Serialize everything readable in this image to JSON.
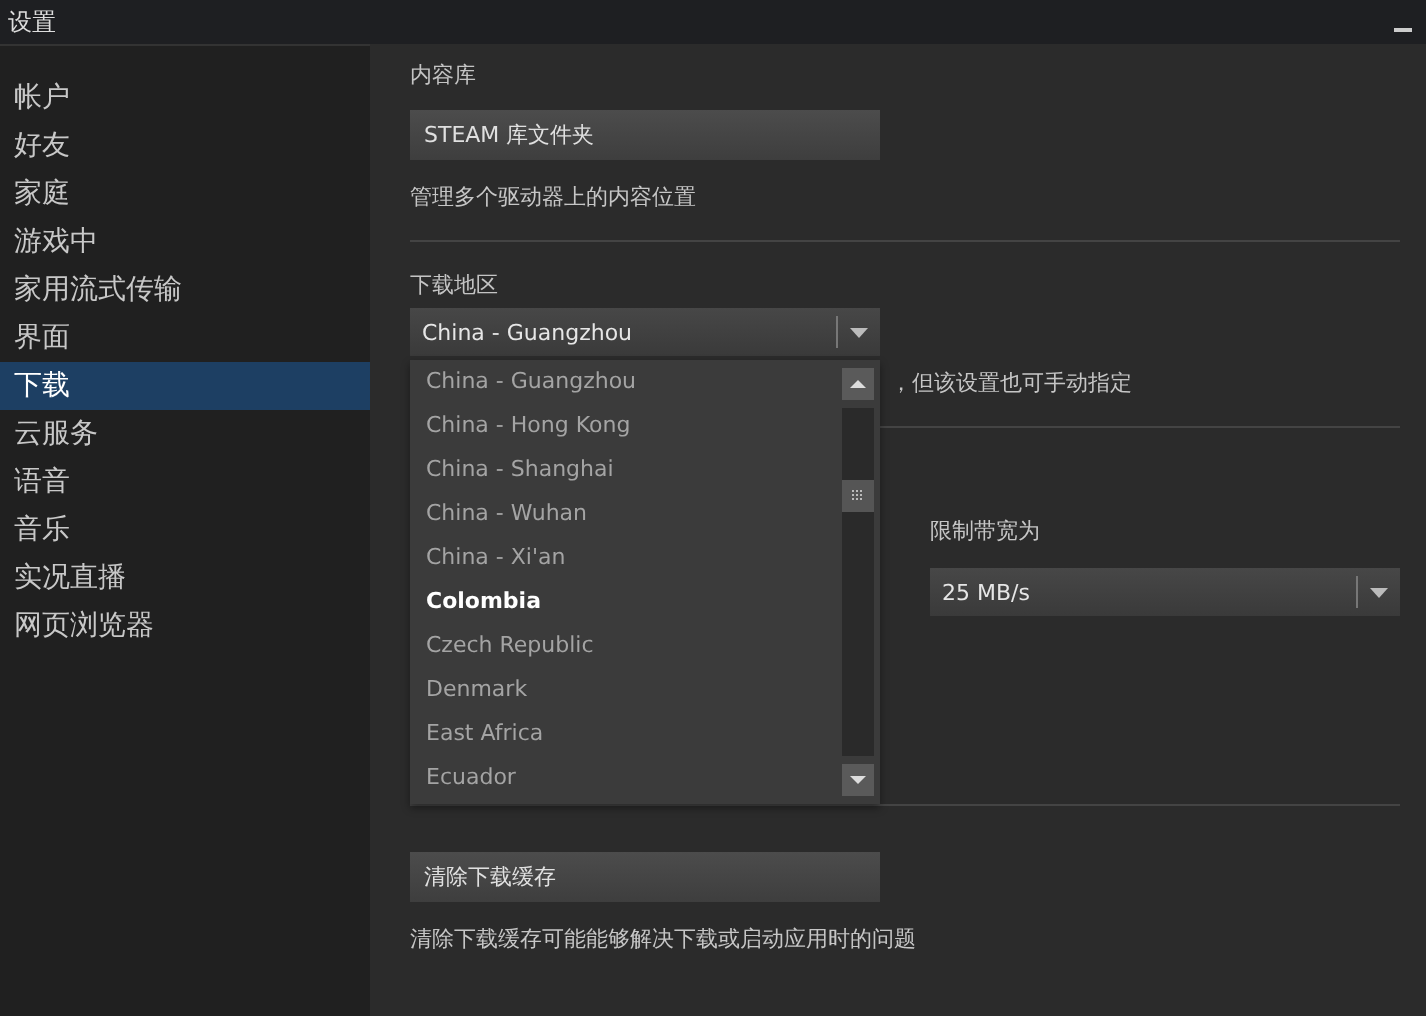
{
  "window": {
    "title": "设置"
  },
  "sidebar": {
    "items": [
      {
        "label": "帐户",
        "selected": false
      },
      {
        "label": "好友",
        "selected": false
      },
      {
        "label": "家庭",
        "selected": false
      },
      {
        "label": "游戏中",
        "selected": false
      },
      {
        "label": "家用流式传输",
        "selected": false
      },
      {
        "label": "界面",
        "selected": false
      },
      {
        "label": "下载",
        "selected": true
      },
      {
        "label": "云服务",
        "selected": false
      },
      {
        "label": "语音",
        "selected": false
      },
      {
        "label": "音乐",
        "selected": false
      },
      {
        "label": "实况直播",
        "selected": false
      },
      {
        "label": "网页浏览器",
        "selected": false
      }
    ]
  },
  "library": {
    "heading": "内容库",
    "button": "STEAM 库文件夹",
    "description": "管理多个驱动器上的内容位置"
  },
  "region": {
    "heading": "下载地区",
    "value": "China - Guangzhou",
    "hint_visible": "，但该设置也可手动指定",
    "options": [
      {
        "label": "China - Guangzhou",
        "highlighted": false
      },
      {
        "label": "China - Hong Kong",
        "highlighted": false
      },
      {
        "label": "China - Shanghai",
        "highlighted": false
      },
      {
        "label": "China - Wuhan",
        "highlighted": false
      },
      {
        "label": "China - Xi'an",
        "highlighted": false
      },
      {
        "label": "Colombia",
        "highlighted": true
      },
      {
        "label": "Czech Republic",
        "highlighted": false
      },
      {
        "label": "Denmark",
        "highlighted": false
      },
      {
        "label": "East Africa",
        "highlighted": false
      },
      {
        "label": "Ecuador",
        "highlighted": false
      }
    ]
  },
  "bandwidth": {
    "label": "限制带宽为",
    "value": "25 MB/s"
  },
  "cache": {
    "button": "清除下载缓存",
    "description": "清除下载缓存可能能够解决下载或启动应用时的问题"
  }
}
